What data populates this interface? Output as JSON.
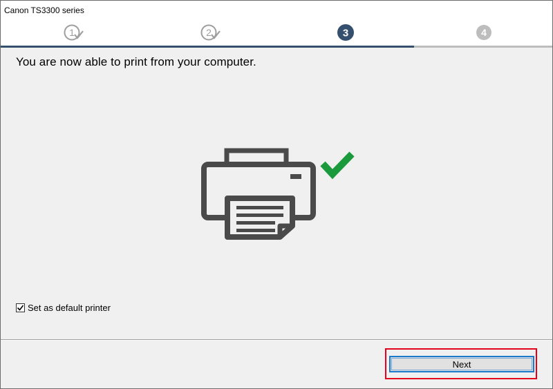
{
  "window": {
    "title": "Canon TS3300 series"
  },
  "steps": [
    {
      "number": "1",
      "state": "done"
    },
    {
      "number": "2",
      "state": "done"
    },
    {
      "number": "3",
      "state": "current"
    },
    {
      "number": "4",
      "state": "pending"
    }
  ],
  "content": {
    "heading": "You are now able to print from your computer.",
    "illustration": {
      "icon": "printer-icon",
      "status_icon": "checkmark-icon",
      "check_color": "#1a9a3c"
    },
    "default_printer": {
      "label": "Set as default printer",
      "checked": true
    }
  },
  "footer": {
    "next_label": "Next"
  },
  "colors": {
    "active_step": "#34506e",
    "inactive_step": "#bdbdbd",
    "highlight": "#e3001b",
    "focus": "#1979ca"
  }
}
